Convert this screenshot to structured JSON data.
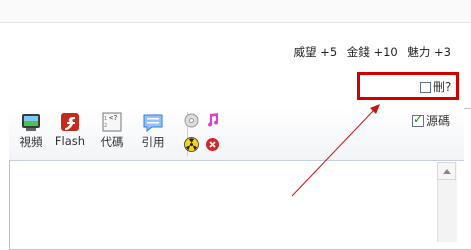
{
  "stats": {
    "prestige": "威望 +5",
    "money": "金錢 +10",
    "charm": "魅力 +3"
  },
  "delete": {
    "label": "刪?"
  },
  "toolbar": {
    "video": "視頻",
    "flash": "Flash",
    "code": "代碼",
    "quote": "引用"
  },
  "source": {
    "label": "源碼"
  },
  "colors": {
    "highlight": "#d10000",
    "arrow": "#c81414"
  }
}
